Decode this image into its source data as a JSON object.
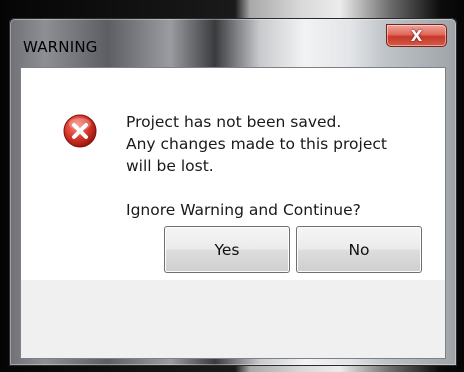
{
  "window": {
    "title": "WARNING",
    "close_glyph": "X"
  },
  "message": {
    "icon": "error-icon",
    "lines": [
      "Project has not been saved.",
      "Any changes made to this project",
      "will be lost."
    ],
    "question": "Ignore Warning and Continue?"
  },
  "buttons": {
    "yes_label": "Yes",
    "no_label": "No"
  },
  "colors": {
    "error_red": "#d8352a",
    "close_red": "#c8382a",
    "client_bg": "#f0f0f0",
    "content_bg": "#ffffff"
  }
}
